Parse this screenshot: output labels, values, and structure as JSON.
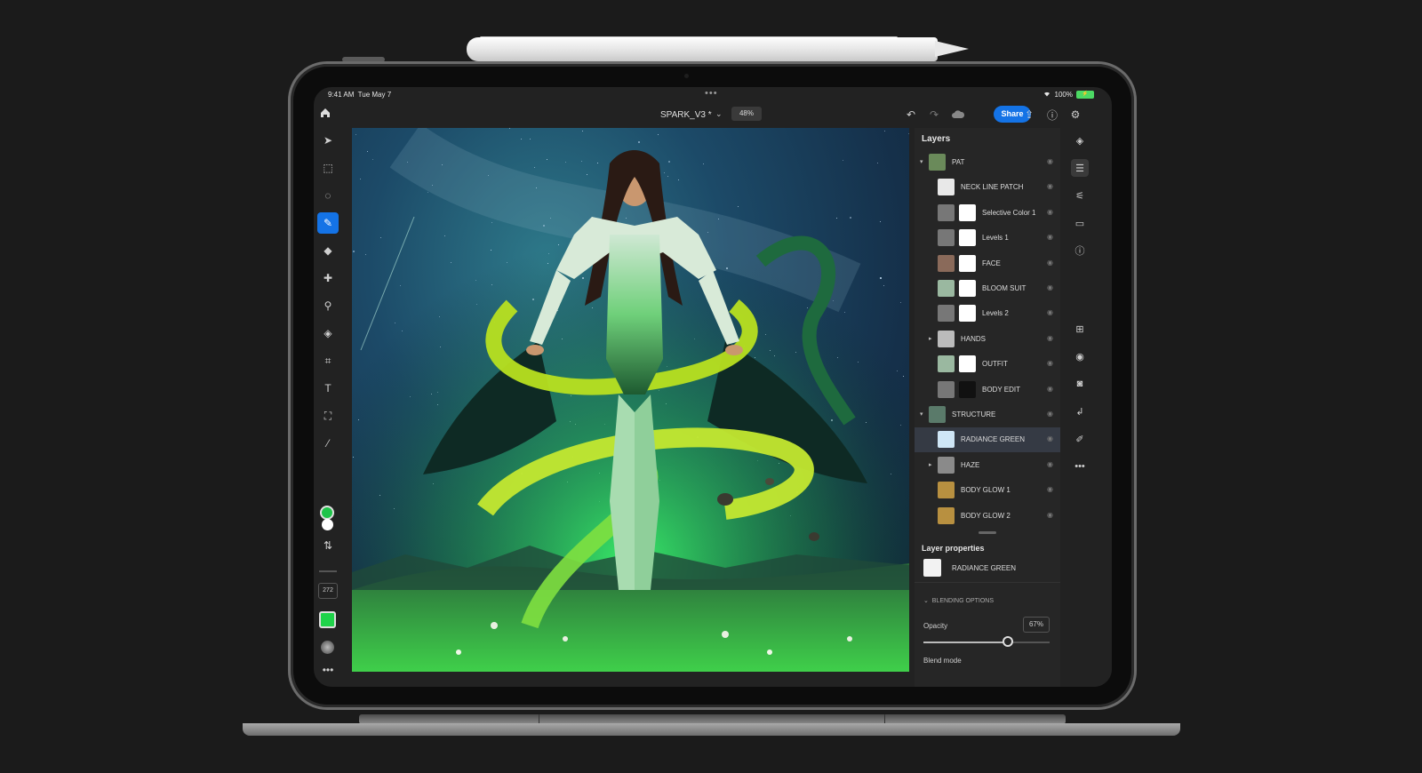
{
  "status": {
    "time": "9:41 AM",
    "date": "Tue May 7",
    "battery": "100%"
  },
  "document": {
    "name": "SPARK_V3 *",
    "zoom": "48%"
  },
  "toolbar": {
    "share_label": "Share"
  },
  "tools": {
    "brush_size": "272",
    "foreground_color": "#1fc44a",
    "background_color": "#ffffff"
  },
  "layers_panel": {
    "title": "Layers",
    "layers": [
      {
        "name": "PAT",
        "indent": 0,
        "twisty": "▾",
        "selected": false,
        "mask": false
      },
      {
        "name": "NECK LINE PATCH",
        "indent": 1,
        "twisty": "",
        "selected": false,
        "mask": false
      },
      {
        "name": "Selective Color 1",
        "indent": 1,
        "twisty": "",
        "selected": false,
        "mask": true
      },
      {
        "name": "Levels 1",
        "indent": 1,
        "twisty": "",
        "selected": false,
        "mask": true
      },
      {
        "name": "FACE",
        "indent": 1,
        "twisty": "",
        "selected": false,
        "mask": true
      },
      {
        "name": "BLOOM SUIT",
        "indent": 1,
        "twisty": "",
        "selected": false,
        "mask": true
      },
      {
        "name": "Levels 2",
        "indent": 1,
        "twisty": "",
        "selected": false,
        "mask": true
      },
      {
        "name": "HANDS",
        "indent": 1,
        "twisty": "▸",
        "selected": false,
        "mask": false
      },
      {
        "name": "OUTFIT",
        "indent": 1,
        "twisty": "",
        "selected": false,
        "mask": true
      },
      {
        "name": "BODY EDIT",
        "indent": 1,
        "twisty": "",
        "selected": false,
        "mask": true
      },
      {
        "name": "STRUCTURE",
        "indent": 0,
        "twisty": "▾",
        "selected": false,
        "mask": false
      },
      {
        "name": "RADIANCE GREEN",
        "indent": 1,
        "twisty": "",
        "selected": true,
        "mask": false
      },
      {
        "name": "HAZE",
        "indent": 1,
        "twisty": "▸",
        "selected": false,
        "mask": false
      },
      {
        "name": "BODY GLOW 1",
        "indent": 1,
        "twisty": "",
        "selected": false,
        "mask": false
      },
      {
        "name": "BODY GLOW 2",
        "indent": 1,
        "twisty": "",
        "selected": false,
        "mask": false
      }
    ]
  },
  "layer_properties": {
    "title": "Layer properties",
    "layer_name": "RADIANCE GREEN",
    "blending_header": "BLENDING OPTIONS",
    "opacity_label": "Opacity",
    "opacity_value": "67%",
    "opacity_fraction": 0.67,
    "blend_mode_label": "Blend mode"
  },
  "colors": {
    "accent": "#1473e6",
    "panel": "#262626",
    "background": "#1b1b1b"
  }
}
